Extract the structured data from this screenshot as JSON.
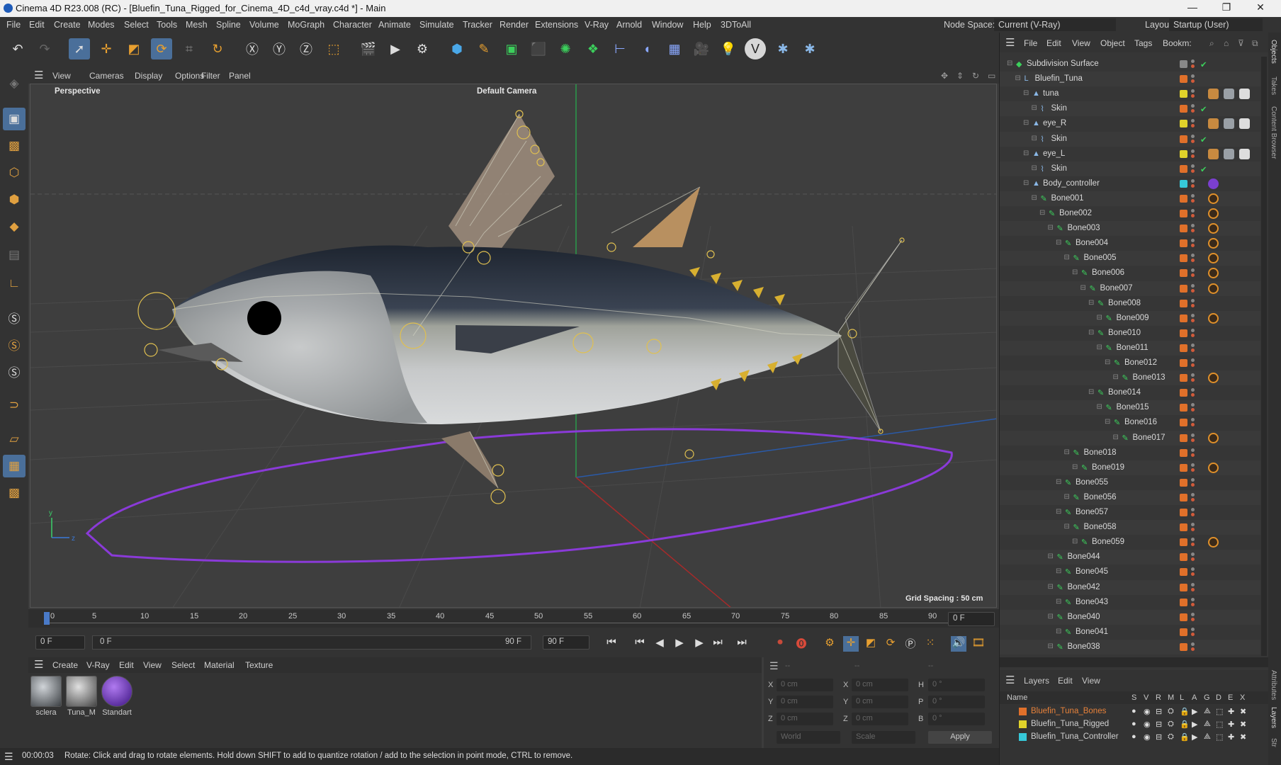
{
  "window": {
    "title": "Cinema 4D R23.008 (RC) - [Bluefin_Tuna_Rigged_for_Cinema_4D_c4d_vray.c4d *] - Main",
    "minimize": "—",
    "maximize": "❐",
    "close": "✕"
  },
  "menu": {
    "items": [
      "File",
      "Edit",
      "Create",
      "Modes",
      "Select",
      "Tools",
      "Mesh",
      "Spline",
      "Volume",
      "MoGraph",
      "Character",
      "Animate",
      "Simulate",
      "Tracker",
      "Render",
      "Extensions",
      "V-Ray",
      "Arnold",
      "Window",
      "Help",
      "3DToAll"
    ],
    "node_space_label": "Node Space:",
    "node_space_value": "Current (V-Ray)",
    "layout_label": "Layout:",
    "layout_value": "Startup (User)"
  },
  "toolbar": {
    "icons": [
      "undo-icon",
      "redo-icon",
      "select-icon",
      "move-icon",
      "scale-icon",
      "rotate-icon",
      "transform-icon",
      "recent-tool-icon",
      "x-axis-icon",
      "y-axis-icon",
      "z-axis-icon",
      "coordinate-system-icon",
      "render-region-icon",
      "render-view-icon",
      "render-settings-icon",
      "cube-icon",
      "pen-icon",
      "subdivision-icon",
      "extrude-icon",
      "cloner-icon",
      "mograph-icon",
      "bend-icon",
      "deformer-icon",
      "floor-icon",
      "camera-icon",
      "light-icon",
      "vray-icon",
      "python-icon",
      "python2-icon"
    ]
  },
  "viewport": {
    "menu": [
      "View",
      "Cameras",
      "Display",
      "Options",
      "Filter",
      "Panel"
    ],
    "label": "Perspective",
    "camera": "Default Camera",
    "grid_spacing": "Grid Spacing : 50 cm"
  },
  "timeline": {
    "ticks": [
      "0",
      "5",
      "10",
      "15",
      "20",
      "25",
      "30",
      "35",
      "40",
      "45",
      "50",
      "55",
      "60",
      "65",
      "70",
      "75",
      "80",
      "85",
      "90"
    ],
    "current_frame": "0 F"
  },
  "transport": {
    "start": "0 F",
    "range_start": "0 F",
    "range_end": "90 F",
    "end": "90 F"
  },
  "materials": {
    "menu": [
      "Create",
      "V-Ray",
      "Edit",
      "View",
      "Select",
      "Material",
      "Texture"
    ],
    "items": [
      {
        "name": "sclera",
        "color": "#6f7a80"
      },
      {
        "name": "Tuna_M",
        "color": "#8a8f92"
      },
      {
        "name": "Standart",
        "color": "#7b3fd0"
      }
    ]
  },
  "coords": {
    "header": [
      "--",
      "--",
      "--"
    ],
    "rows": [
      {
        "a": "X",
        "av": "0 cm",
        "b": "X",
        "bv": "0 cm",
        "c": "H",
        "cv": "0 °"
      },
      {
        "a": "Y",
        "av": "0 cm",
        "b": "Y",
        "bv": "0 cm",
        "c": "P",
        "cv": "0 °"
      },
      {
        "a": "Z",
        "av": "0 cm",
        "b": "Z",
        "bv": "0 cm",
        "c": "B",
        "cv": "0 °"
      }
    ],
    "world": "World",
    "scale": "Scale",
    "apply": "Apply"
  },
  "status": {
    "time": "00:00:03",
    "message": "Rotate: Click and drag to rotate elements. Hold down SHIFT to add to quantize rotation / add to the selection in point mode, CTRL to remove."
  },
  "objects": {
    "menu": [
      "File",
      "Edit",
      "View",
      "Object",
      "Tags",
      "Bookm:"
    ],
    "rows": [
      {
        "name": "Subdivision Surface",
        "indent": 0,
        "type": "subd",
        "color": "#888888",
        "tag": "check"
      },
      {
        "name": "Bluefin_Tuna",
        "indent": 1,
        "type": "null",
        "color": "#e0702a",
        "tag": ""
      },
      {
        "name": "tuna",
        "indent": 2,
        "type": "mesh",
        "color": "#e0d22a",
        "tag": "mats"
      },
      {
        "name": "Skin",
        "indent": 3,
        "type": "skin",
        "color": "#e0702a",
        "tag": "check"
      },
      {
        "name": "eye_R",
        "indent": 2,
        "type": "mesh",
        "color": "#e0d22a",
        "tag": "mats"
      },
      {
        "name": "Skin",
        "indent": 3,
        "type": "skin",
        "color": "#e0702a",
        "tag": "check"
      },
      {
        "name": "eye_L",
        "indent": 2,
        "type": "mesh",
        "color": "#e0d22a",
        "tag": "mats"
      },
      {
        "name": "Skin",
        "indent": 3,
        "type": "skin",
        "color": "#e0702a",
        "tag": "check"
      },
      {
        "name": "Body_controller",
        "indent": 2,
        "type": "mesh",
        "color": "#36c8d8",
        "tag": "purple"
      },
      {
        "name": "Bone001",
        "indent": 3,
        "type": "bone",
        "color": "#e0702a",
        "tag": "ik"
      },
      {
        "name": "Bone002",
        "indent": 4,
        "type": "bone",
        "color": "#e0702a",
        "tag": "ik"
      },
      {
        "name": "Bone003",
        "indent": 5,
        "type": "bone",
        "color": "#e0702a",
        "tag": "ik"
      },
      {
        "name": "Bone004",
        "indent": 6,
        "type": "bone",
        "color": "#e0702a",
        "tag": "ik"
      },
      {
        "name": "Bone005",
        "indent": 7,
        "type": "bone",
        "color": "#e0702a",
        "tag": "ik"
      },
      {
        "name": "Bone006",
        "indent": 8,
        "type": "bone",
        "color": "#e0702a",
        "tag": "ik"
      },
      {
        "name": "Bone007",
        "indent": 9,
        "type": "bone",
        "color": "#e0702a",
        "tag": "ik"
      },
      {
        "name": "Bone008",
        "indent": 10,
        "type": "bone",
        "color": "#e0702a",
        "tag": ""
      },
      {
        "name": "Bone009",
        "indent": 11,
        "type": "bone",
        "color": "#e0702a",
        "tag": "ik"
      },
      {
        "name": "Bone010",
        "indent": 10,
        "type": "bone",
        "color": "#e0702a",
        "tag": ""
      },
      {
        "name": "Bone011",
        "indent": 11,
        "type": "bone",
        "color": "#e0702a",
        "tag": ""
      },
      {
        "name": "Bone012",
        "indent": 12,
        "type": "bone",
        "color": "#e0702a",
        "tag": ""
      },
      {
        "name": "Bone013",
        "indent": 13,
        "type": "bone",
        "color": "#e0702a",
        "tag": "ik"
      },
      {
        "name": "Bone014",
        "indent": 10,
        "type": "bone",
        "color": "#e0702a",
        "tag": ""
      },
      {
        "name": "Bone015",
        "indent": 11,
        "type": "bone",
        "color": "#e0702a",
        "tag": ""
      },
      {
        "name": "Bone016",
        "indent": 12,
        "type": "bone",
        "color": "#e0702a",
        "tag": ""
      },
      {
        "name": "Bone017",
        "indent": 13,
        "type": "bone",
        "color": "#e0702a",
        "tag": "ik"
      },
      {
        "name": "Bone018",
        "indent": 7,
        "type": "bone",
        "color": "#e0702a",
        "tag": ""
      },
      {
        "name": "Bone019",
        "indent": 8,
        "type": "bone",
        "color": "#e0702a",
        "tag": "ik"
      },
      {
        "name": "Bone055",
        "indent": 6,
        "type": "bone",
        "color": "#e0702a",
        "tag": ""
      },
      {
        "name": "Bone056",
        "indent": 7,
        "type": "bone",
        "color": "#e0702a",
        "tag": ""
      },
      {
        "name": "Bone057",
        "indent": 6,
        "type": "bone",
        "color": "#e0702a",
        "tag": ""
      },
      {
        "name": "Bone058",
        "indent": 7,
        "type": "bone",
        "color": "#e0702a",
        "tag": ""
      },
      {
        "name": "Bone059",
        "indent": 8,
        "type": "bone",
        "color": "#e0702a",
        "tag": "ik"
      },
      {
        "name": "Bone044",
        "indent": 5,
        "type": "bone",
        "color": "#e0702a",
        "tag": ""
      },
      {
        "name": "Bone045",
        "indent": 6,
        "type": "bone",
        "color": "#e0702a",
        "tag": ""
      },
      {
        "name": "Bone042",
        "indent": 5,
        "type": "bone",
        "color": "#e0702a",
        "tag": ""
      },
      {
        "name": "Bone043",
        "indent": 6,
        "type": "bone",
        "color": "#e0702a",
        "tag": ""
      },
      {
        "name": "Bone040",
        "indent": 5,
        "type": "bone",
        "color": "#e0702a",
        "tag": ""
      },
      {
        "name": "Bone041",
        "indent": 6,
        "type": "bone",
        "color": "#e0702a",
        "tag": ""
      },
      {
        "name": "Bone038",
        "indent": 5,
        "type": "bone",
        "color": "#e0702a",
        "tag": ""
      }
    ]
  },
  "layers": {
    "menu": [
      "Layers",
      "Edit",
      "View"
    ],
    "name_header": "Name",
    "cols": [
      "S",
      "V",
      "R",
      "M",
      "L",
      "A",
      "G",
      "D",
      "E",
      "X"
    ],
    "items": [
      {
        "name": "Bluefin_Tuna_Bones",
        "color": "#e0702a",
        "text_color": "#e8823a"
      },
      {
        "name": "Bluefin_Tuna_Rigged",
        "color": "#e0d22a",
        "text_color": "#d0d0d0"
      },
      {
        "name": "Bluefin_Tuna_Controller",
        "color": "#36c8d8",
        "text_color": "#d0d0d0"
      }
    ]
  },
  "side_tabs": [
    "Objects",
    "Takes",
    "Content Browser",
    "Attributes",
    "Layers",
    "Str"
  ]
}
